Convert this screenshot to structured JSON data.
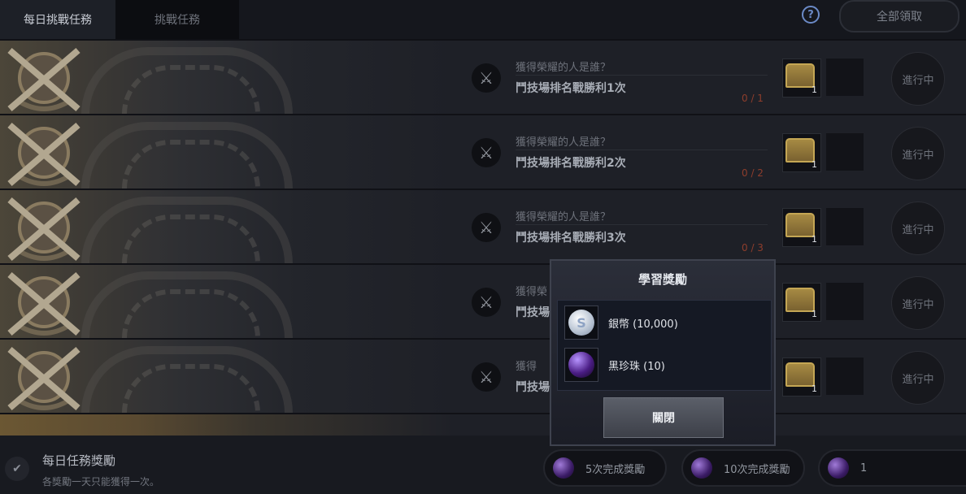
{
  "tabs": [
    {
      "label": "每日挑戰任務",
      "active": true
    },
    {
      "label": "挑戰任務",
      "active": false
    }
  ],
  "header": {
    "help_icon": "question-circle-icon",
    "help_label": "?",
    "claim_all_label": "全部領取"
  },
  "quests": [
    {
      "subtitle": "獲得榮耀的人是誰？",
      "title": "鬥技場排名戰勝利1次",
      "progress": "0 / 1",
      "reward_count": "1",
      "status": "進行中"
    },
    {
      "subtitle": "獲得榮耀的人是誰？",
      "title": "鬥技場排名戰勝利2次",
      "progress": "0 / 2",
      "reward_count": "1",
      "status": "進行中"
    },
    {
      "subtitle": "獲得榮耀的人是誰？",
      "title": "鬥技場排名戰勝利3次",
      "progress": "0 / 3",
      "reward_count": "1",
      "status": "進行中"
    },
    {
      "subtitle": "獲得榮",
      "title": "鬥技場",
      "progress": "",
      "reward_count": "1",
      "status": "進行中"
    },
    {
      "subtitle": "獲得",
      "title": "鬥技場",
      "progress": "",
      "reward_count": "1",
      "status": "進行中"
    }
  ],
  "footer": {
    "title": "每日任務獎勵",
    "subtitle": "各獎勵一天只能獲得一次。",
    "milestones": [
      "5次完成獎勵",
      "10次完成獎勵",
      "1"
    ]
  },
  "dialog": {
    "title": "學習獎勵",
    "rewards": [
      {
        "name": "銀幣 (10,000)",
        "icon": "silver-coin-icon",
        "glyph": "S"
      },
      {
        "name": "黑珍珠 (10)",
        "icon": "black-pearl-icon"
      }
    ],
    "close_label": "關閉"
  },
  "colors": {
    "accent_progress": "#8e3d2c",
    "help_icon": "#6b8ac6"
  }
}
